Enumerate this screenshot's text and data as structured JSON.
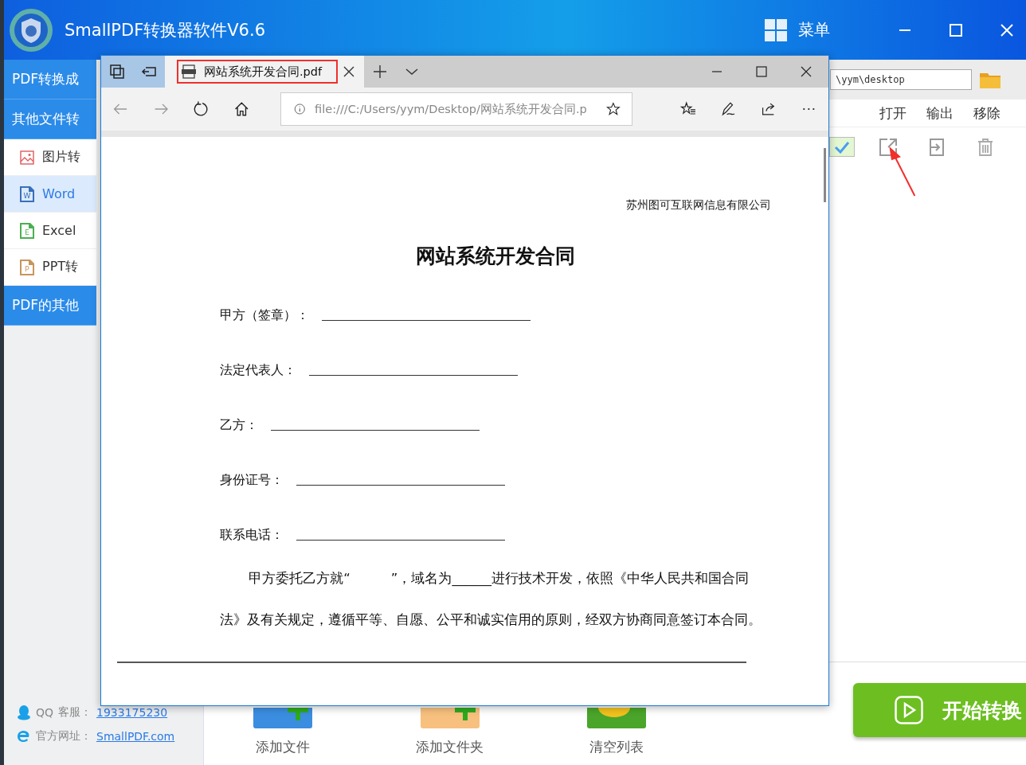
{
  "app": {
    "title": "SmallPDF转换器软件V6.6",
    "menu_label": "菜单"
  },
  "sidebar": [
    {
      "kind": "section",
      "label": "PDF转换成"
    },
    {
      "kind": "section",
      "label": "其他文件转"
    },
    {
      "kind": "item",
      "label": "图片转",
      "selected": false
    },
    {
      "kind": "item",
      "label": "Word",
      "badge": "W",
      "color": "#3a6fb8",
      "selected": true
    },
    {
      "kind": "item",
      "label": "Excel",
      "badge": "E",
      "color": "#4caf50",
      "selected": false
    },
    {
      "kind": "item",
      "label": "PPT转",
      "badge": "P",
      "color": "#c9955a",
      "selected": false
    },
    {
      "kind": "section",
      "label": "PDF的其他"
    }
  ],
  "contact": {
    "qq_label": "QQ",
    "qq_service": "客服：",
    "qq_value": "1933175230",
    "site_label": "官方网址：",
    "site_value": "SmallPDF.com"
  },
  "output_path": "\\yym\\desktop",
  "columns": [
    "打开",
    "输出",
    "移除"
  ],
  "rows": [
    {
      "checked": true
    }
  ],
  "toolbar": [
    {
      "label": "添加文件"
    },
    {
      "label": "添加文件夹"
    },
    {
      "label": "清空列表"
    }
  ],
  "start_button": "开始转换",
  "browser": {
    "tab_title": "网站系统开发合同.pdf",
    "address": "file:///C:/Users/yym/Desktop/网站系统开发合同.p",
    "document": {
      "company": "苏州图可互联网信息有限公司",
      "title": "网站系统开发合同",
      "fields": [
        {
          "label": "甲方（签章）："
        },
        {
          "label": "法定代表人："
        },
        {
          "label": "乙方："
        },
        {
          "label": "身份证号："
        },
        {
          "label": "联系电话："
        }
      ],
      "paragraph": "甲方委托乙方就“　　　”，域名为______进行技术开发，依照《中华人民共和国合同法》及有关规定，遵循平等、自愿、公平和诚实信用的原则，经双方协商同意签订本合同。"
    }
  }
}
